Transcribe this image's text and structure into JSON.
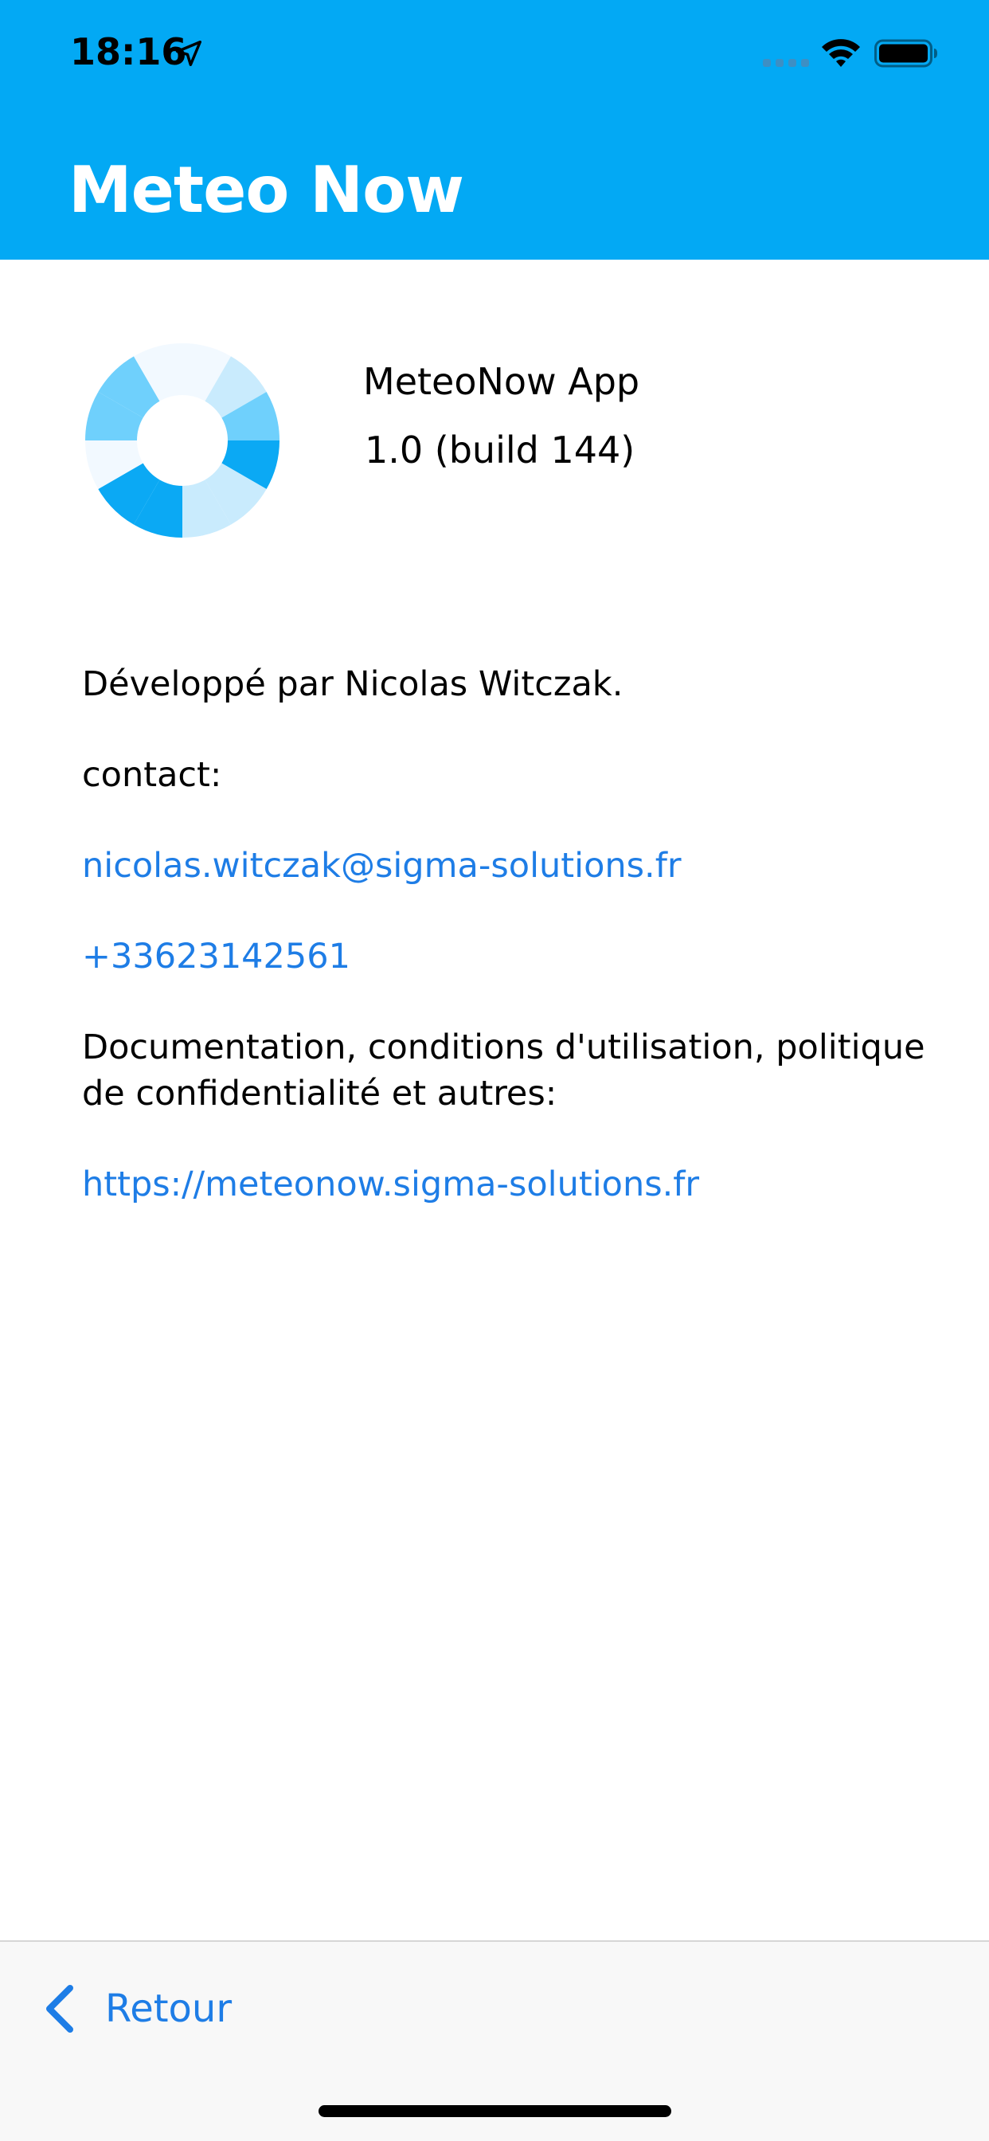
{
  "status_bar": {
    "time": "18:16",
    "icons": [
      "location-arrow-icon",
      "cellular-signal-icon",
      "wifi-icon",
      "battery-icon"
    ]
  },
  "header": {
    "title": "Meteo Now",
    "background_color": "#03A9F4"
  },
  "about": {
    "app_name": "MeteoNow App",
    "version": "1.0 (build 144)",
    "logo_icon": "meteonow-logo-icon"
  },
  "info": {
    "developer": "Développé par Nicolas Witczak.",
    "contact_label": "contact:",
    "email": "nicolas.witczak@sigma-solutions.fr",
    "phone": "+33623142561",
    "docs_label": "Documentation, conditions d'utilisation, politique de confidentialité et autres:",
    "docs_url": "https://meteonow.sigma-solutions.fr",
    "link_color": "#1E7DE6"
  },
  "bottom_bar": {
    "back_label": "Retour",
    "back_icon": "chevron-left-icon"
  }
}
